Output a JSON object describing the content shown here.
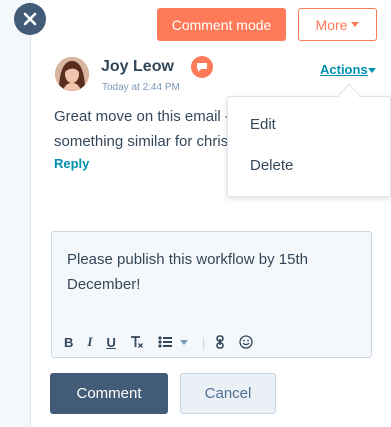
{
  "header": {
    "close_icon": "close-icon",
    "comment_mode_label": "Comment mode",
    "more_label": "More"
  },
  "comment": {
    "author": "Joy Leow",
    "timestamp": "Today at 2:44 PM",
    "badge_icon": "note-icon",
    "actions_label": "Actions",
    "text_line1": "Great move on this email -",
    "text_line2": "something similar for chris",
    "reply_label": "Reply"
  },
  "actions_menu": {
    "items": [
      "Edit",
      "Delete"
    ]
  },
  "editor": {
    "value": "Please publish this workflow by 15th December!",
    "toolbar": {
      "bold": "B",
      "italic": "I",
      "underline": "U",
      "clear_format": "T",
      "list_icon": "list-icon",
      "link_icon": "link-icon",
      "emoji_icon": "emoji-icon"
    }
  },
  "footer": {
    "submit_label": "Comment",
    "cancel_label": "Cancel"
  },
  "colors": {
    "accent": "#ff7a59",
    "primary_dark": "#425b76",
    "link": "#0091ae"
  }
}
